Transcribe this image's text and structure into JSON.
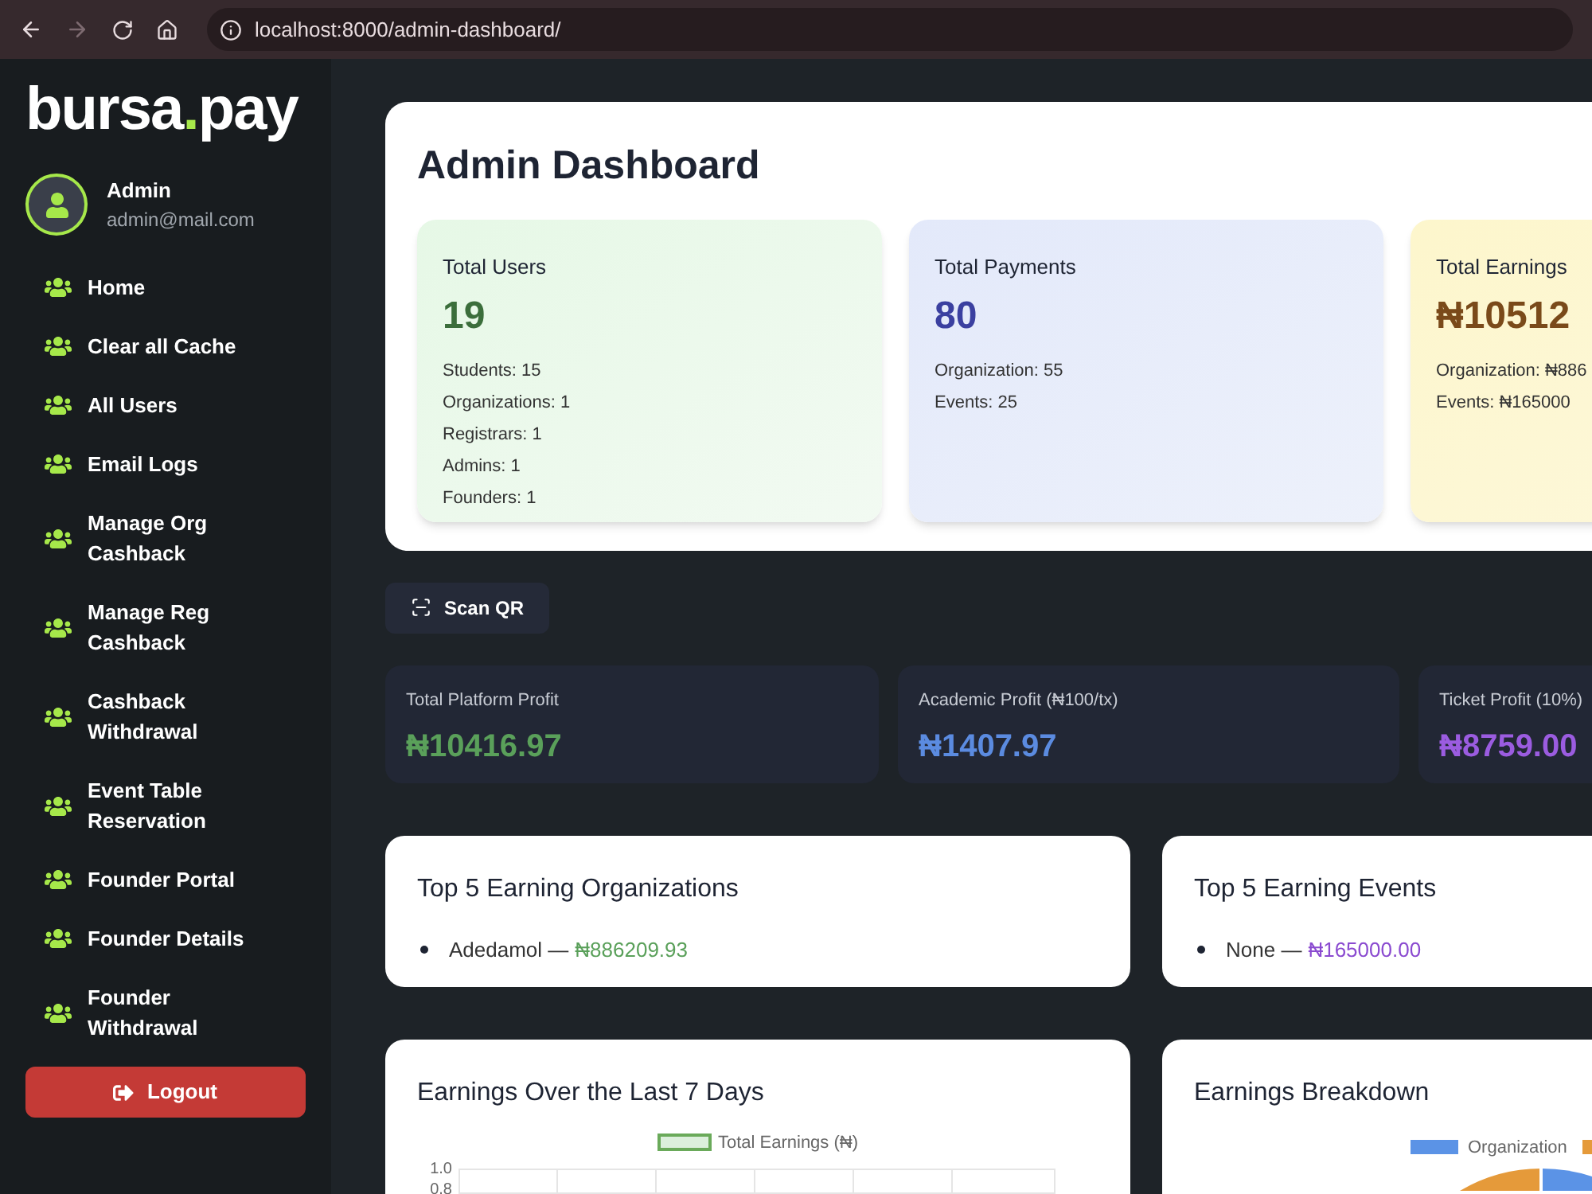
{
  "browser": {
    "url": "localhost:8000/admin-dashboard/",
    "forward_disabled": true
  },
  "sidebar": {
    "logo": {
      "left": "bursa",
      "dot": ".",
      "right": "pay"
    },
    "user": {
      "name": "Admin",
      "email": "admin@mail.com"
    },
    "items": [
      {
        "label": "Home"
      },
      {
        "label": "Clear all Cache"
      },
      {
        "label": "All Users"
      },
      {
        "label": "Email Logs"
      },
      {
        "label": "Manage Org Cashback"
      },
      {
        "label": "Manage Reg Cashback"
      },
      {
        "label": "Cashback Withdrawal"
      },
      {
        "label": "Event Table Reservation"
      },
      {
        "label": "Founder Portal"
      },
      {
        "label": "Founder Details"
      },
      {
        "label": "Founder Withdrawal"
      }
    ],
    "logout": "Logout"
  },
  "title": "Admin Dashboard",
  "stat_cards": [
    {
      "kind": "users",
      "title": "Total Users",
      "value": "19",
      "color": "#3b6e3b",
      "lines": [
        "Students: 15",
        "Organizations: 1",
        "Registrars: 1",
        "Admins: 1",
        "Founders: 1"
      ]
    },
    {
      "kind": "payments",
      "title": "Total Payments",
      "value": "80",
      "color": "#3b40a0",
      "lines": [
        "Organization: 55",
        "Events: 25"
      ]
    },
    {
      "kind": "earnings",
      "title": "Total Earnings",
      "value": "₦10512",
      "color": "#7a4a1a",
      "lines": [
        "Organization: ₦886",
        "Events: ₦165000"
      ]
    }
  ],
  "scan_button": "Scan QR",
  "profit_cards": [
    {
      "label": "Total Platform Profit",
      "value": "₦10416.97",
      "color": "#5aa05a"
    },
    {
      "label": "Academic Profit (₦100/tx)",
      "value": "₦1407.97",
      "color": "#5b8be0"
    },
    {
      "label": "Ticket Profit (10%)",
      "value": "₦8759.00",
      "color": "#9b5ce0"
    }
  ],
  "top_lists": [
    {
      "title": "Top 5 Earning Organizations",
      "color": "#5aa05a",
      "items": [
        {
          "name": "Adedamol —",
          "amount": "₦886209.93"
        }
      ]
    },
    {
      "title": "Top 5 Earning Events",
      "color": "#8a4ad0",
      "items": [
        {
          "name": "None —",
          "amount": "₦165000.00"
        }
      ]
    }
  ],
  "line_chart": {
    "title": "Earnings Over the Last 7 Days",
    "legend": "Total Earnings (₦)",
    "y_ticks": [
      "1.0",
      "0.8"
    ]
  },
  "pie_chart": {
    "title": "Earnings Breakdown",
    "legend": [
      {
        "label": "Organization",
        "color": "#5b93e6"
      },
      {
        "color": "#e59a3a"
      }
    ]
  }
}
